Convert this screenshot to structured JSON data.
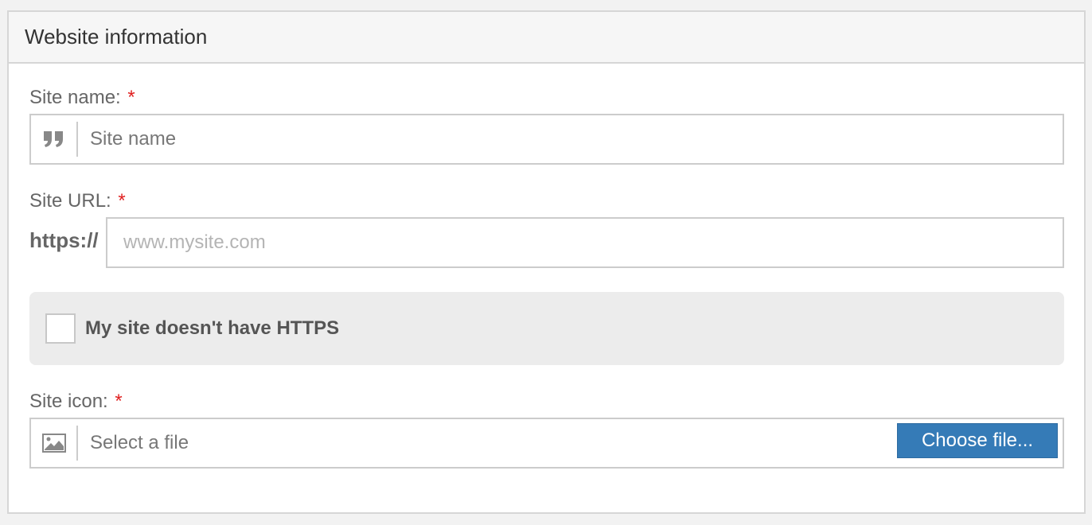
{
  "panel": {
    "title": "Website information"
  },
  "site_name": {
    "label": "Site name:",
    "required_mark": "*",
    "value": "Site name",
    "icon": "quote-icon"
  },
  "site_url": {
    "label": "Site URL:",
    "required_mark": "*",
    "prefix": "https://",
    "placeholder": "www.mysite.com",
    "value": ""
  },
  "https_option": {
    "label": "My site doesn't have HTTPS",
    "checked": false
  },
  "site_icon": {
    "label": "Site icon:",
    "required_mark": "*",
    "value": "Select a file",
    "icon": "image-icon",
    "button_label": "Choose file..."
  },
  "colors": {
    "required": "#e02020",
    "button": "#357bb7",
    "border": "#cccccc"
  }
}
